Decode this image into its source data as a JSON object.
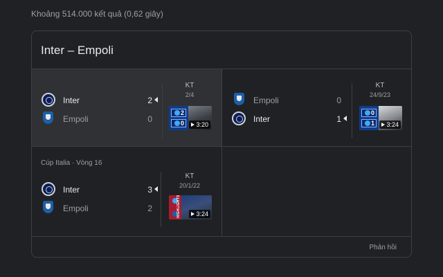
{
  "result_stats": "Khoảng 514.000 kết quả (0,62 giây)",
  "card": {
    "title": "Inter – Empoli",
    "feedback": "Phản hồi"
  },
  "matches": [
    {
      "competition": "",
      "home": {
        "name": "Inter",
        "score": "2",
        "winner": true,
        "logo": "inter-logo"
      },
      "away": {
        "name": "Empoli",
        "score": "0",
        "winner": false,
        "logo": "empoli-logo"
      },
      "status": "KT",
      "date": "2/4",
      "video_duration": "3:20",
      "thumb_scores": [
        "2",
        "0"
      ]
    },
    {
      "competition": "",
      "home": {
        "name": "Empoli",
        "score": "0",
        "winner": false,
        "logo": "empoli-logo"
      },
      "away": {
        "name": "Inter",
        "score": "1",
        "winner": true,
        "logo": "inter-logo"
      },
      "status": "KT",
      "date": "24/9/23",
      "video_duration": "3:24",
      "thumb_scores": [
        "0",
        "1"
      ]
    },
    {
      "competition": "Cúp Italia · Vòng 16",
      "home": {
        "name": "Inter",
        "score": "3",
        "winner": true,
        "logo": "inter-logo"
      },
      "away": {
        "name": "Empoli",
        "score": "2",
        "winner": false,
        "logo": "empoli-logo"
      },
      "status": "KT",
      "date": "20/1/22",
      "video_duration": "3:24",
      "thumb_label": "HIGHLIGHTS"
    }
  ],
  "colors": {
    "background": "#202124",
    "card_border": "#3c4043",
    "highlight_bg": "#303134",
    "primary_text": "#e8eaed",
    "secondary_text": "#9aa0a6"
  }
}
